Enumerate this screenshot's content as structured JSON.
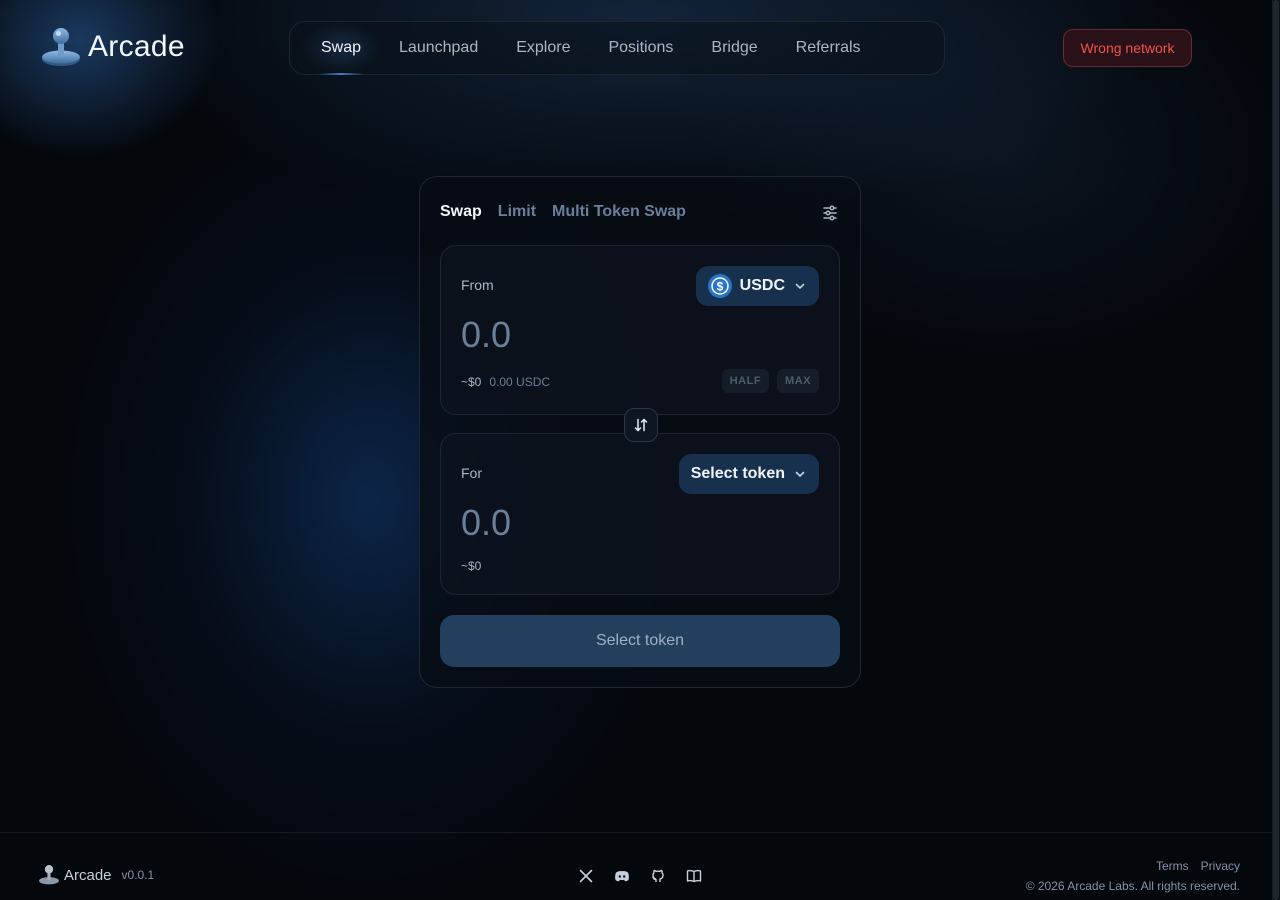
{
  "app": {
    "name": "Arcade"
  },
  "nav": {
    "items": [
      {
        "label": "Swap",
        "active": true
      },
      {
        "label": "Launchpad"
      },
      {
        "label": "Explore"
      },
      {
        "label": "Positions"
      },
      {
        "label": "Bridge"
      },
      {
        "label": "Referrals"
      }
    ]
  },
  "network": {
    "status_label": "Wrong network",
    "color": "#f0534f"
  },
  "swap": {
    "tabs": [
      {
        "label": "Swap",
        "active": true
      },
      {
        "label": "Limit"
      },
      {
        "label": "Multi Token Swap"
      }
    ],
    "from": {
      "label": "From",
      "amount_placeholder": "0.0",
      "token_symbol": "USDC",
      "token_icon": "usdc-coin-icon",
      "usd_value": "~$0",
      "balance": "0.00 USDC",
      "half_label": "HALF",
      "max_label": "MAX"
    },
    "for": {
      "label": "For",
      "amount_placeholder": "0.0",
      "token_button_label": "Select token",
      "usd_value": "~$0"
    },
    "submit_label": "Select token"
  },
  "footer": {
    "brand": "Arcade",
    "version": "v0.0.1",
    "links": [
      {
        "label": "Terms"
      },
      {
        "label": "Privacy"
      }
    ],
    "copyright": "© 2026 Arcade Labs. All rights reserved.",
    "socials": [
      "x-icon",
      "discord-icon",
      "github-icon",
      "docs-book-icon"
    ]
  },
  "colors": {
    "accent": "#3e7cc8",
    "button_bg": "#233f5e",
    "token_btn_bg": "#16304d"
  }
}
